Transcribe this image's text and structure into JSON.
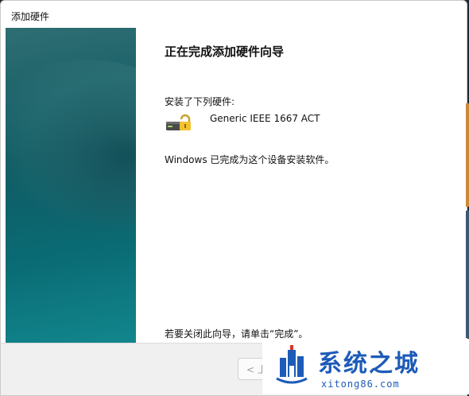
{
  "window": {
    "title": "添加硬件"
  },
  "page": {
    "heading": "正在完成添加硬件向导",
    "installed_label": "安装了下列硬件:",
    "device_name": "Generic IEEE 1667 ACT",
    "status_text": "Windows 已完成为这个设备安装软件。",
    "closing_text": "若要关闭此向导，请单击“完成”。"
  },
  "footer": {
    "back_label": "< 上"
  },
  "watermark": {
    "title": "系统之城",
    "url": "xitong86.com"
  },
  "icons": {
    "device": "usb-drive-lock-icon",
    "watermark_logo": "castle-logo-icon"
  },
  "colors": {
    "banner": "#0f5a63",
    "watermark_blue": "#1d5bb8"
  }
}
